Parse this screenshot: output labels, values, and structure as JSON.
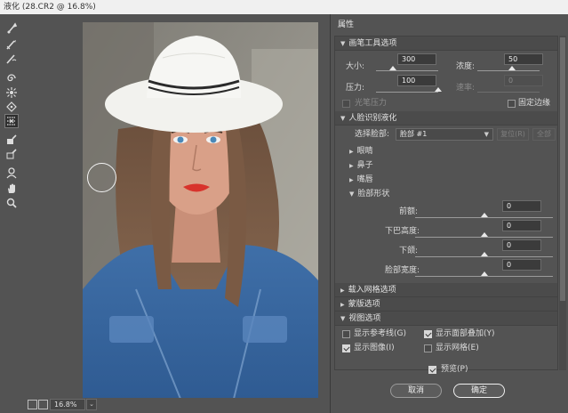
{
  "window": {
    "title": "液化 (28.CR2 @ 16.8%)"
  },
  "status": {
    "zoom": "16.8%",
    "zoom_dropdown": "⌄"
  },
  "panel": {
    "title": "属性",
    "brush": {
      "header": "画笔工具选项",
      "size_label": "大小:",
      "size_value": "300",
      "density_label": "浓度:",
      "density_value": "50",
      "pressure_label": "压力:",
      "pressure_value": "100",
      "rate_label": "速率:",
      "rate_value": "0",
      "stylus_label": "光笔压力",
      "pin_edges_label": "固定边缘"
    },
    "face": {
      "header": "人脸识别液化",
      "select_face_label": "选择脸部:",
      "select_face_value": "脸部 #1",
      "reset_label": "复位(R)",
      "all_label": "全部",
      "eyes": "眼睛",
      "nose": "鼻子",
      "mouth": "嘴唇",
      "face_shape": "脸部形状",
      "forehead_label": "前额:",
      "forehead_value": "0",
      "chin_height_label": "下巴高度:",
      "chin_height_value": "0",
      "jawline_label": "下颌:",
      "jawline_value": "0",
      "face_width_label": "脸部宽度:",
      "face_width_value": "0"
    },
    "load_mesh": {
      "header": "载入网格选项"
    },
    "mask": {
      "header": "蒙版选项"
    },
    "view": {
      "header": "视图选项",
      "show_guides": "显示参考线(G)",
      "show_face_overlay": "显示面部叠加(Y)",
      "show_image": "显示图像(I)",
      "show_mesh": "显示网格(E)"
    },
    "preview_label": "预览(P)",
    "cancel_label": "取消",
    "ok_label": "确定"
  },
  "colors": {
    "accent": "#f0f0f0",
    "panel_bg": "#535353",
    "section_bg": "#4b4b4b"
  }
}
